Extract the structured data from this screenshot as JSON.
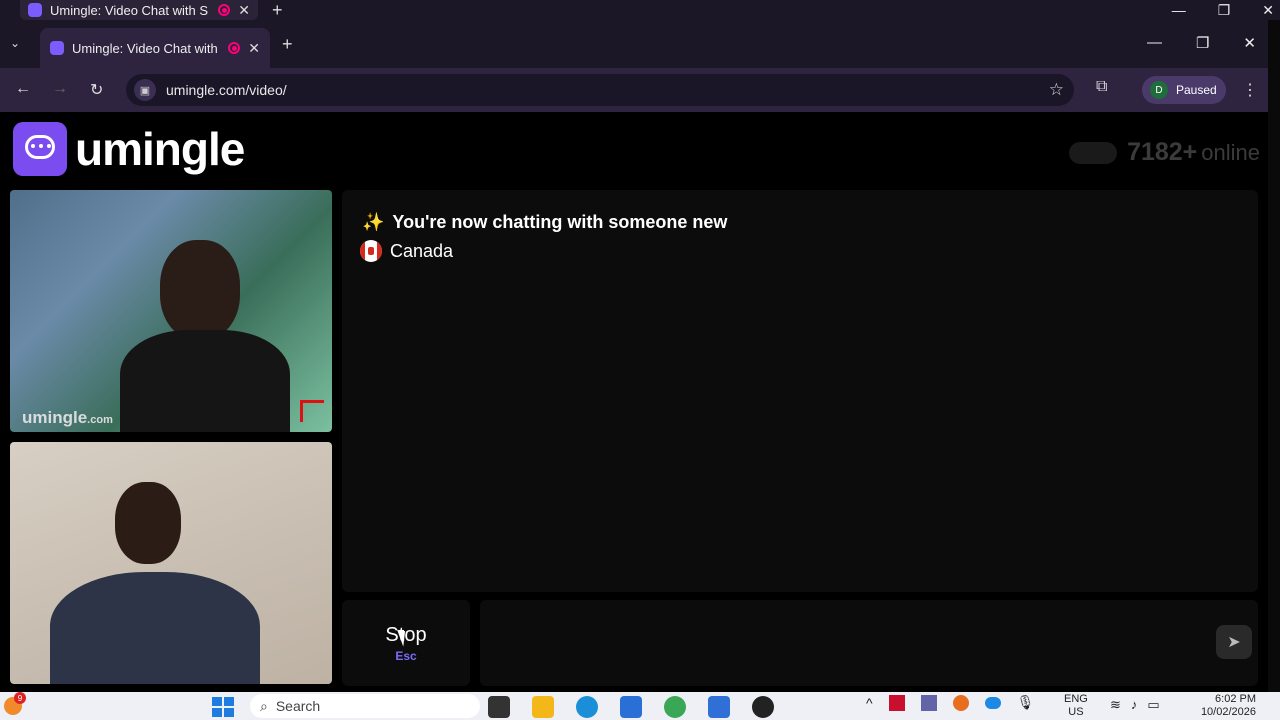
{
  "outer_browser": {
    "tab_title": "Umingle: Video Chat with S",
    "new_tab": "+",
    "close_tab": "✕",
    "minimize": "—",
    "restore": "❐",
    "close": "✕"
  },
  "browser": {
    "tab_dropdown": "⌄",
    "tab_title": "Umingle: Video Chat with S",
    "close_tab": "✕",
    "new_tab": "+",
    "minimize": "—",
    "restore": "❐",
    "close": "✕",
    "back": "←",
    "forward": "→",
    "reload": "↻",
    "url": "umingle.com/video/",
    "bookmark": "☆",
    "extensions": "⧉",
    "profile_initial": "D",
    "profile_status": "Paused",
    "menu": "⋮"
  },
  "header": {
    "logo_text": "umingle",
    "online_count": "7182+",
    "online_label": "online"
  },
  "videos": {
    "stranger_watermark": "umingle",
    "stranger_watermark_suffix": ".com"
  },
  "chat": {
    "icon": "✨",
    "status_message": "You're now chatting with someone new",
    "country": "Canada"
  },
  "controls": {
    "stop_label": "Stop",
    "stop_shortcut": "Esc",
    "message_placeholder": "",
    "send_icon": "➤"
  },
  "taskbar": {
    "notification_count": "9",
    "search_label": "Search",
    "tray_chevron": "^",
    "lang_top": "ENG",
    "lang_bottom": "US",
    "time": "6:02 PM",
    "date": "10/02/2026"
  },
  "colors": {
    "brand": "#7b4cf0",
    "stop_key": "#7b6cf6"
  }
}
